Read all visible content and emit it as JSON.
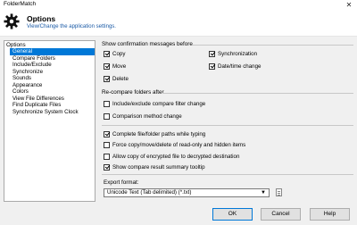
{
  "window": {
    "title": "FolderMatch",
    "close_glyph": "✕"
  },
  "header": {
    "title": "Options",
    "subtitle": "View/Change the application settings."
  },
  "nav": {
    "root": "Options",
    "items": [
      {
        "label": "General",
        "selected": true
      },
      {
        "label": "Compare Folders"
      },
      {
        "label": "Include/Exclude"
      },
      {
        "label": "Synchronize"
      },
      {
        "label": "Sounds"
      },
      {
        "label": "Appearance"
      },
      {
        "label": "Colors"
      },
      {
        "label": "View File Differences"
      },
      {
        "label": "Find Duplicate Files"
      },
      {
        "label": "Synchronize System Clock"
      }
    ]
  },
  "confirm_group": {
    "label": "Show confirmation messages before",
    "copy": {
      "label": "Copy",
      "checked": true
    },
    "synchronization": {
      "label": "Synchronization",
      "checked": true
    },
    "move": {
      "label": "Move",
      "checked": true
    },
    "datetime": {
      "label": "Date/time change",
      "checked": true
    },
    "delete": {
      "label": "Delete",
      "checked": true
    }
  },
  "recompare_group": {
    "label": "Re-compare folders after",
    "filter_change": {
      "label": "Include/exclude compare filter change",
      "checked": false
    },
    "method_change": {
      "label": "Comparison method change",
      "checked": false
    }
  },
  "misc": {
    "complete_paths": {
      "label": "Complete file/folder paths while typing",
      "checked": true
    },
    "force_readonly": {
      "label": "Force copy/move/delete of read-only and hidden items",
      "checked": false
    },
    "allow_encrypted": {
      "label": "Allow copy of encrypted file to decrypted destination",
      "checked": false
    },
    "summary_tooltip": {
      "label": "Show compare result summary tooltip",
      "checked": true
    }
  },
  "export": {
    "label": "Export format:",
    "selected": "Unicode Text (Tab delimited) (*.txt)"
  },
  "buttons": {
    "ok": "OK",
    "cancel": "Cancel",
    "help": "Help"
  },
  "colors": {
    "accent": "#0078d7",
    "subtitle": "#1a5aa6"
  }
}
